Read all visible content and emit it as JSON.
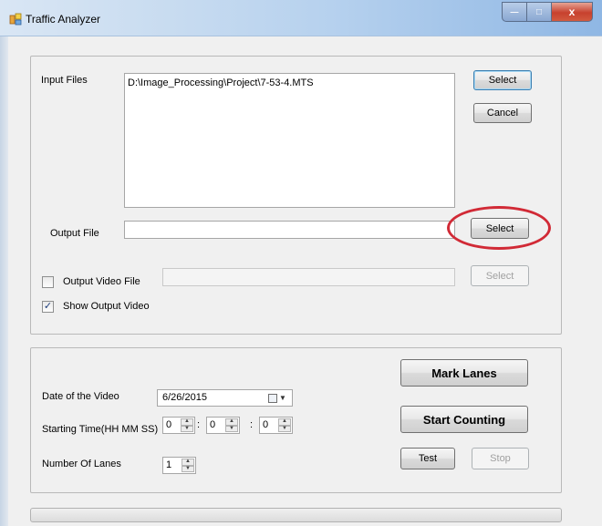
{
  "window": {
    "title": "Traffic Analyzer",
    "controls": {
      "minimize": "—",
      "maximize": "□",
      "close": "x"
    }
  },
  "files": {
    "input_label": "Input Files",
    "input_items": [
      "D:\\Image_Processing\\Project\\7-53-4.MTS"
    ],
    "select_input_label": "Select",
    "cancel_label": "Cancel",
    "output_label": "Output  File",
    "output_value": "",
    "select_output_label": "Select",
    "output_video_label": "Output Video File",
    "output_video_checked": false,
    "output_video_value": "",
    "select_video_label": "Select",
    "show_output_label": "Show Output Video",
    "show_output_checked": true
  },
  "settings": {
    "date_label": "Date of the Video",
    "date_value": "6/26/2015",
    "start_time_label": "Starting Time(HH MM SS)",
    "hours": "0",
    "minutes": "0",
    "seconds": "0",
    "separator": ":",
    "lanes_label": "Number Of Lanes",
    "lanes": "1"
  },
  "actions": {
    "mark_lanes": "Mark Lanes",
    "start_counting": "Start Counting",
    "test": "Test",
    "stop": "Stop"
  },
  "progress": {
    "value": 0
  },
  "colors": {
    "annotation_ring": "#d12a36",
    "focus_border": "#3c7fb1"
  }
}
